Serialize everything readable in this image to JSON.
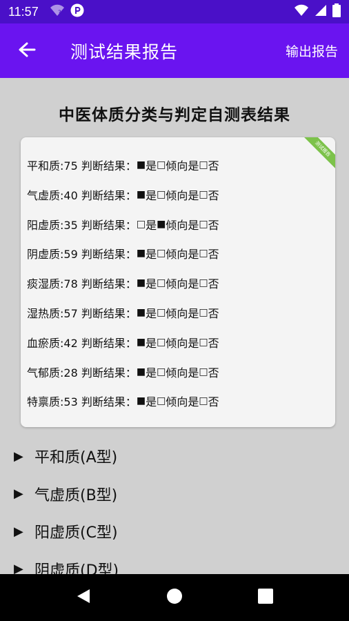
{
  "status": {
    "time": "11:57",
    "wifi_question": "?"
  },
  "app_bar": {
    "title": "测试结果报告",
    "export_label": "输出报告"
  },
  "page_heading": "中医体质分类与判定自测表结果",
  "ribbon_label": "测试报告",
  "results": [
    {
      "name": "平和质",
      "score": 75,
      "label": "平和质:75 判断结果：",
      "marks": [
        "■",
        "□",
        "□"
      ]
    },
    {
      "name": "气虚质",
      "score": 40,
      "label": "气虚质:40 判断结果：",
      "marks": [
        "■",
        "□",
        "□"
      ]
    },
    {
      "name": "阳虚质",
      "score": 35,
      "label": "阳虚质:35 判断结果：",
      "marks": [
        "□",
        "■",
        "□"
      ]
    },
    {
      "name": "阴虚质",
      "score": 59,
      "label": "阴虚质:59 判断结果：",
      "marks": [
        "■",
        "□",
        "□"
      ]
    },
    {
      "name": "痰湿质",
      "score": 78,
      "label": "痰湿质:78 判断结果：",
      "marks": [
        "■",
        "□",
        "□"
      ]
    },
    {
      "name": "湿热质",
      "score": 57,
      "label": "湿热质:57 判断结果：",
      "marks": [
        "■",
        "□",
        "□"
      ]
    },
    {
      "name": "血瘀质",
      "score": 42,
      "label": "血瘀质:42 判断结果：",
      "marks": [
        "■",
        "□",
        "□"
      ]
    },
    {
      "name": "气郁质",
      "score": 28,
      "label": "气郁质:28 判断结果：",
      "marks": [
        "■",
        "□",
        "□"
      ]
    },
    {
      "name": "特禀质",
      "score": 53,
      "label": "特禀质:53 判断结果：",
      "marks": [
        "■",
        "□",
        "□"
      ]
    }
  ],
  "option_labels": [
    "是",
    "倾向是",
    "否"
  ],
  "sections": [
    {
      "label": "平和质(A型)"
    },
    {
      "label": "气虚质(B型)"
    },
    {
      "label": "阳虚质(C型)"
    },
    {
      "label": "阴虚质(D型)"
    }
  ],
  "colors": {
    "status_bar": "#4a10c8",
    "app_bar": "#6a14f0",
    "background": "#d0d0d0",
    "card": "#f4f4f4",
    "ribbon": "#7cc24a"
  }
}
